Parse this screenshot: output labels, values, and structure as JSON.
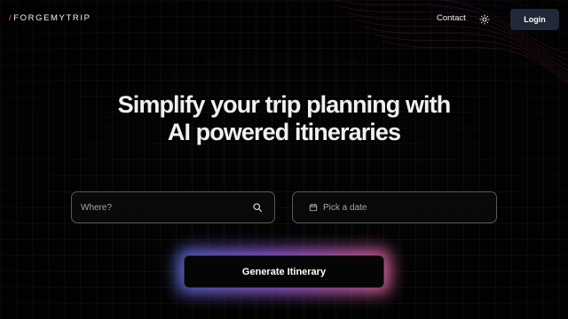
{
  "header": {
    "logo_prefix": "/",
    "logo_text": "FORGEMYTRIP",
    "contact_label": "Contact",
    "theme_icon": "sun-icon",
    "login_label": "Login"
  },
  "hero": {
    "line1": "Simplify your trip planning with",
    "line2": "AI powered itineraries"
  },
  "search": {
    "where_placeholder": "Where?",
    "where_icon": "search-icon",
    "date_placeholder": "Pick a date",
    "date_icon": "calendar-icon"
  },
  "cta": {
    "label": "Generate Itinerary"
  },
  "colors": {
    "background": "#030303",
    "accent_logo_slash": "#ff5a36",
    "login_bg": "#1f2937",
    "glow_start": "#6d7bff",
    "glow_mid": "#b56bff",
    "glow_end": "#ff6fb0"
  }
}
